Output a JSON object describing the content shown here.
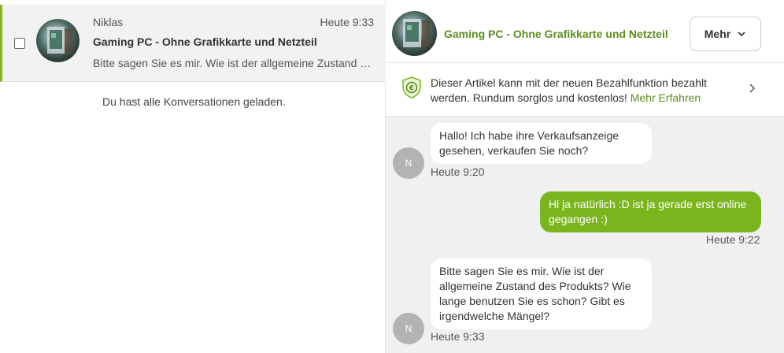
{
  "conversation": {
    "name": "Niklas",
    "time": "Heute 9:33",
    "title": "Gaming PC - Ohne Grafikkarte und Netzteil",
    "preview": "Bitte sagen Sie es mir. Wie ist der allgemeine Zustand des Produkts? Wie lange benutzen Sie es schon?"
  },
  "list_footer": "Du hast alle Konversationen geladen.",
  "chat": {
    "ad_title": "Gaming PC - Ohne Grafikkarte und Netzteil",
    "more_label": "Mehr",
    "banner_text": "Dieser Artikel kann mit der neuen Bezahlfunktion bezahlt werden. Rundum sorglos und kostenlos!",
    "banner_link": "Mehr Erfahren",
    "avatar_initial": "N",
    "messages": [
      {
        "direction": "in",
        "text": "Hallo! Ich habe ihre Verkaufsanzeige gesehen, verkaufen Sie noch?",
        "time": "Heute 9:20"
      },
      {
        "direction": "out",
        "text": "Hi ja natürlich :D ist ja gerade erst online gegangen :)",
        "time": "Heute 9:22"
      },
      {
        "direction": "in",
        "text": "Bitte sagen Sie es mir. Wie ist der allgemeine Zustand des Produkts? Wie lange benutzen Sie es schon? Gibt es irgendwelche Mängel?",
        "time": "Heute 9:33"
      }
    ]
  },
  "icons": {
    "avatar": "pc-photo-thumbnail",
    "banner": "euro-shield-icon",
    "more": "chevron-down-icon",
    "banner_arrow": "chevron-right-icon"
  },
  "colors": {
    "accent_green": "#86b817",
    "bubble_out": "#7ab51d",
    "title_green": "#5a8f1c"
  }
}
